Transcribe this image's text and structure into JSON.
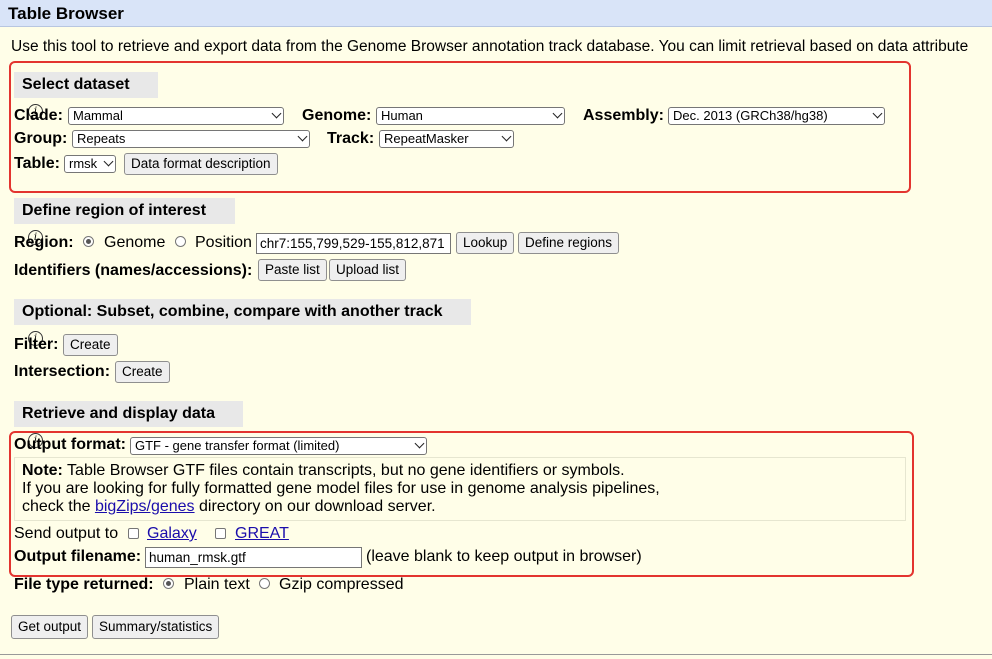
{
  "title": "Table Browser",
  "intro": "Use this tool to retrieve and export data from the Genome Browser annotation track database. You can limit retrieval based on data attribute",
  "select_dataset": {
    "heading": "Select dataset",
    "clade_label": "Clade:",
    "clade_value": "Mammal",
    "genome_label": "Genome:",
    "genome_value": "Human",
    "assembly_label": "Assembly:",
    "assembly_value": "Dec. 2013 (GRCh38/hg38)",
    "group_label": "Group:",
    "group_value": "Repeats",
    "track_label": "Track:",
    "track_value": "RepeatMasker",
    "table_label": "Table:",
    "table_value": "rmsk",
    "data_format_button": "Data format description"
  },
  "region": {
    "heading": "Define region of interest",
    "region_label": "Region:",
    "genome_option": "Genome",
    "position_option": "Position",
    "position_value": "chr7:155,799,529-155,812,871",
    "lookup_button": "Lookup",
    "define_regions_button": "Define regions",
    "identifiers_label": "Identifiers (names/accessions):",
    "paste_list_button": "Paste list",
    "upload_list_button": "Upload list"
  },
  "optional": {
    "heading": "Optional: Subset, combine, compare with another track",
    "filter_label": "Filter:",
    "filter_button": "Create",
    "intersection_label": "Intersection:",
    "intersection_button": "Create"
  },
  "retrieve": {
    "heading": "Retrieve and display data",
    "output_format_label": "Output format:",
    "output_format_value": "GTF - gene transfer format (limited)",
    "note_bold": "Note:",
    "note_line1": " Table Browser GTF files contain transcripts, but no gene identifiers or symbols.",
    "note_line2": "If you are looking for fully formatted gene model files for use in genome analysis pipelines,",
    "note_line3_pre": "check the ",
    "note_link": "bigZips/genes",
    "note_line3_post": " directory on our download server.",
    "send_output_label": "Send output to",
    "galaxy_label": "Galaxy",
    "great_label": "GREAT",
    "output_filename_label": "Output filename:",
    "output_filename_value": "human_rmsk.gtf",
    "output_filename_hint": "(leave blank to keep output in browser)",
    "file_type_label": "File type returned:",
    "plain_text_option": "Plain text",
    "gzip_option": "Gzip compressed",
    "get_output_button": "Get output",
    "summary_button": "Summary/statistics"
  },
  "colors": {
    "highlight_border": "#e3342f",
    "page_background": "#fffee8",
    "title_background": "#d9e4f8",
    "section_background": "#e8e8e8"
  },
  "icons": {
    "info": "info-circle-icon",
    "dropdown": "chevron-down-icon"
  }
}
